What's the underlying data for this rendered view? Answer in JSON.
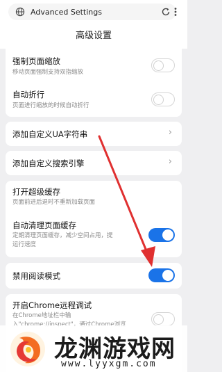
{
  "address_bar": {
    "text": "Advanced Settings"
  },
  "page": {
    "title": "高级设置"
  },
  "settings": {
    "force_zoom": {
      "title": "强制页面缩放",
      "desc": "移动页面强制支持双指缩放",
      "enabled": false
    },
    "auto_wrap": {
      "title": "自动折行",
      "desc": "页面进行缩放的时候自动折行",
      "enabled": false
    },
    "custom_ua": {
      "title": "添加自定义UA字符串"
    },
    "custom_search": {
      "title": "添加自定义搜索引擎"
    },
    "super_cache": {
      "title": "打开超级缓存",
      "desc": "页面前进后退时不重新加载页面",
      "enabled": false
    },
    "auto_clear_cache": {
      "title": "自动清理页面缓存",
      "desc1": "定期清理页面缓存，减少空间占用，提",
      "desc2": "运行速度",
      "enabled": true
    },
    "disable_reader": {
      "title": "禁用阅读模式",
      "enabled": true
    },
    "chrome_debug": {
      "title": "开启Chrome远程调试",
      "desc1": "在Chrome地址栏中输",
      "desc2": "入\"chrome://inspect\"，通过Chrome浏览",
      "enabled": false
    }
  },
  "watermark": {
    "title": "龙渊游戏网",
    "url": "www.lyyxgm.com"
  },
  "colors": {
    "accent": "#1a73e8",
    "arrow": "#e03030"
  }
}
